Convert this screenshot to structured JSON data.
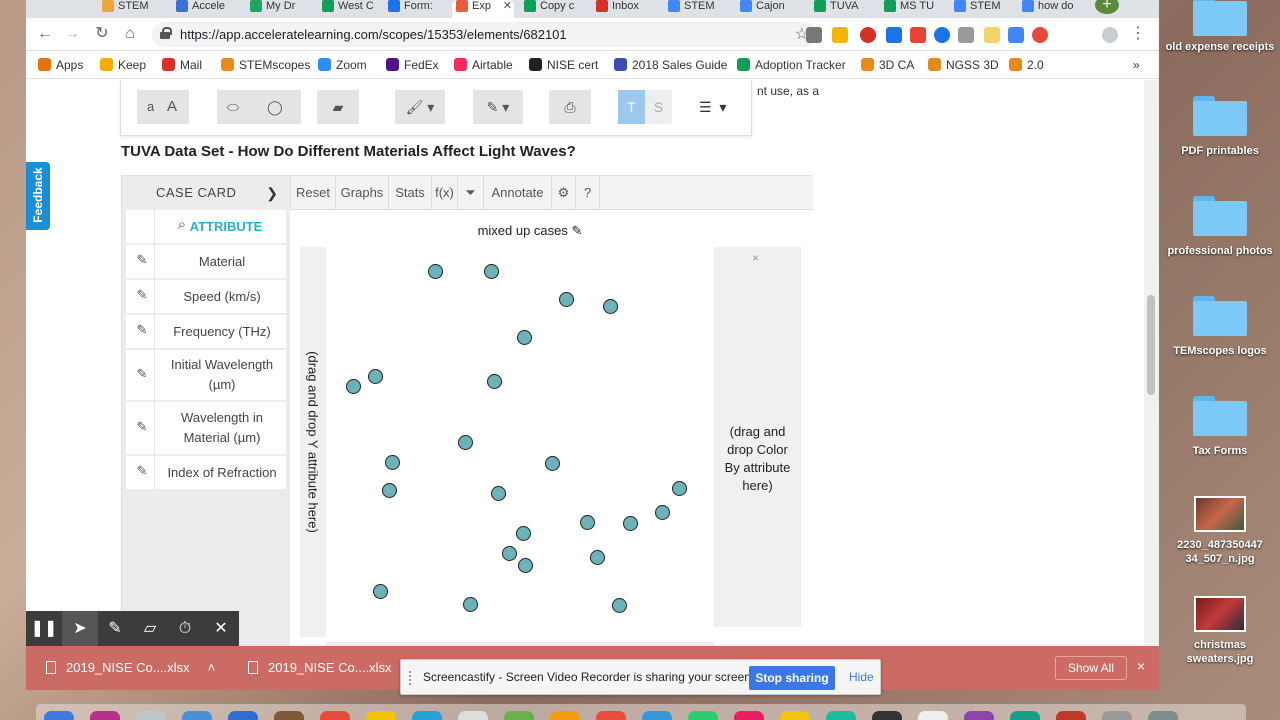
{
  "browser": {
    "tabs": [
      {
        "label": "STEM",
        "color": "#f0a53a"
      },
      {
        "label": "Accele",
        "color": "#3b6fd6"
      },
      {
        "label": "My Dr",
        "color": "#1fa463"
      },
      {
        "label": "West C",
        "color": "#0f9d58"
      },
      {
        "label": "Form:",
        "color": "#1a73e8"
      },
      {
        "label": "Exp",
        "color": "#e85d3a",
        "active": true
      },
      {
        "label": "Copy c",
        "color": "#0f9d58"
      },
      {
        "label": "Inbox",
        "color": "#d93025"
      },
      {
        "label": "STEM",
        "color": "#4285f4"
      },
      {
        "label": "Cajon",
        "color": "#4285f4"
      },
      {
        "label": "TUVA",
        "color": "#0f9d58"
      },
      {
        "label": "MS TU",
        "color": "#0f9d58"
      },
      {
        "label": "STEM",
        "color": "#4285f4"
      },
      {
        "label": "how do",
        "color": "#4285f4"
      }
    ],
    "url": "https://app.acceleratelearning.com/scopes/15353/elements/682101",
    "bookmarks": [
      {
        "label": "Apps",
        "color": "#e8710a"
      },
      {
        "label": "Keep",
        "color": "#f9ab00"
      },
      {
        "label": "Mail",
        "color": "#d93025"
      },
      {
        "label": "STEMscopes",
        "color": "#e88a1a"
      },
      {
        "label": "Zoom",
        "color": "#2d8cff"
      },
      {
        "label": "FedEx",
        "color": "#4d148c"
      },
      {
        "label": "Airtable",
        "color": "#f82b60"
      },
      {
        "label": "NISE cert",
        "color": "#222"
      },
      {
        "label": "2018 Sales Guide",
        "color": "#3b4cb8"
      },
      {
        "label": "Adoption Tracker",
        "color": "#0f9d58"
      },
      {
        "label": "3D CA",
        "color": "#e88a1a"
      },
      {
        "label": "NGSS 3D",
        "color": "#e88a1a"
      },
      {
        "label": "2.0",
        "color": "#e88a1a"
      }
    ],
    "bookmarks_more": "»"
  },
  "page": {
    "feedback_label": "Feedback",
    "cut_text": "nt use, as a",
    "title": "TUVA Data Set - How Do Different Materials Affect Light Waves?",
    "reader_toolbar": {
      "font_small": "a",
      "font_large": "A",
      "text_toggle_t": "T",
      "text_toggle_s": "S"
    }
  },
  "tuva": {
    "case_card_label": "CASE CARD",
    "attribute_header": "ATTRIBUTE",
    "attributes": [
      "Material",
      "Speed (km/s)",
      "Frequency (THz)",
      "Initial Wavelength (µm)",
      "Wavelength in Material (µm)",
      "Index of Refraction"
    ],
    "toolbar": [
      "Reset",
      "Graphs",
      "Stats",
      "f(x)"
    ],
    "annotate_label": "Annotate",
    "graph_title": "mixed up cases",
    "y_drop": "(drag and drop Y attribute here)",
    "color_drop": "(drag and drop Color By attribute here)",
    "color_drop_close": "×",
    "point_color": "#6bb3b8"
  },
  "chart_data": {
    "type": "scatter",
    "title": "mixed up cases",
    "xlabel": "",
    "ylabel": "",
    "points": [
      [
        434.5,
        270.5
      ],
      [
        490.5,
        270.5
      ],
      [
        565.5,
        298.5
      ],
      [
        609.5,
        305.5
      ],
      [
        523.5,
        336.5
      ],
      [
        374.5,
        375.5
      ],
      [
        352.5,
        385.5
      ],
      [
        493.5,
        380.5
      ],
      [
        464.5,
        441.5
      ],
      [
        391.5,
        461.5
      ],
      [
        551.5,
        462.5
      ],
      [
        388.5,
        489.5
      ],
      [
        497.5,
        492.5
      ],
      [
        678.5,
        487.5
      ],
      [
        661.5,
        511.5
      ],
      [
        586.5,
        521.5
      ],
      [
        629.5,
        522.5
      ],
      [
        522.5,
        532.5
      ],
      [
        508.5,
        552.5
      ],
      [
        596.5,
        556.5
      ],
      [
        524.5,
        564.5
      ],
      [
        379.5,
        590.5
      ],
      [
        469.5,
        603.5
      ],
      [
        618.5,
        604.5
      ]
    ]
  },
  "screencastify": {
    "message": "Screencastify - Screen Video Recorder is sharing your screen.",
    "stop_label": "Stop sharing",
    "hide_label": "Hide"
  },
  "downloads": {
    "files": [
      "2019_NISE Co....xlsx",
      "2019_NISE Co....xlsx"
    ],
    "show_all": "Show All",
    "close": "×"
  },
  "desktop": {
    "items": [
      {
        "label": "old expense receipts",
        "kind": "folder"
      },
      {
        "label": "PDF printables",
        "kind": "folder"
      },
      {
        "label": "professional photos",
        "kind": "folder"
      },
      {
        "label": "TEMscopes logos",
        "kind": "folder"
      },
      {
        "label": "Tax Forms",
        "kind": "folder"
      },
      {
        "label": "2230_487350447 34_507_n.jpg",
        "kind": "image"
      },
      {
        "label": "christmas sweaters.jpg",
        "kind": "image"
      }
    ]
  }
}
